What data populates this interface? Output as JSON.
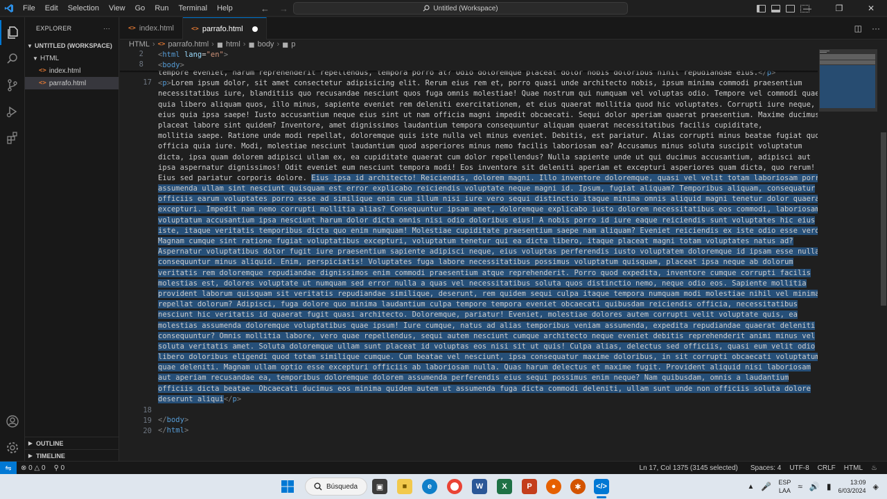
{
  "menu": {
    "items": [
      "File",
      "Edit",
      "Selection",
      "View",
      "Go",
      "Run",
      "Terminal",
      "Help"
    ]
  },
  "titlebar": {
    "search_text": "Untitled (Workspace)",
    "nav_back": "←",
    "nav_forward": "→"
  },
  "sidebar": {
    "title": "EXPLORER",
    "more": "···",
    "workspace": "UNTITLED (WORKSPACE)",
    "folder": "HTML",
    "files": [
      "index.html",
      "parrafo.html"
    ],
    "outline": "OUTLINE",
    "timeline": "TIMELINE"
  },
  "tabs": [
    {
      "label": "index.html"
    },
    {
      "label": "parrafo.html"
    }
  ],
  "breadcrumb": {
    "items": [
      "HTML",
      "parrafo.html",
      "html",
      "body",
      "p"
    ]
  },
  "editor": {
    "gutter": [
      "2",
      "8",
      "17",
      "18",
      "19",
      "20"
    ],
    "sticky": {
      "line2_tag": "html",
      "line2_attr": "lang",
      "line2_value": "\"en\"",
      "line8_tag": "body"
    },
    "first_partial": "tempore eveniet, harum reprehenderit repellendus, tempora porro at? Odio doloremque placeat dolor nobis doloribus nihil repudiandae eius.",
    "paragraph_unselected": [
      "Lorem ipsum dolor, sit amet consectetur adipisicing elit. Rerum eius rem et, porro quasi unde architecto nobis, ipsum minima commodi praesentium",
      "necessitatibus iure, blanditiis quo recusandae nesciunt quos fuga omnis molestiae! Quae nostrum qui numquam vel voluptas odio. Tempore vel commodi quae",
      "quia libero aliquam quos, illo minus, sapiente eveniet rem deleniti exercitationem, et eius quaerat mollitia quod hic voluptates. Corrupti iure neque,",
      "eius quia ipsa saepe! Iusto accusantium neque eius sint ut nam officia magni impedit obcaecati. Sequi dolor aperiam quaerat praesentium. Maxime ducimus",
      "placeat labore sint quidem? Inventore, amet dignissimos laudantium tempora consequuntur aliquam quaerat necessitatibus facilis cupiditate,",
      "mollitia saepe. Ratione unde modi repellat, doloremque quis iste nulla vel minus eveniet. Debitis, est pariatur. Alias corrupti minus beatae fugiat quos",
      "officia quia iure. Modi, molestiae nesciunt laudantium quod asperiores minus nemo facilis laboriosam ea? Accusamus minus soluta suscipit voluptatum",
      "dicta, ipsa quam dolorem adipisci ullam ex, ea cupiditate quaerat cum dolor repellendus? Nulla sapiente unde ut qui ducimus accusantium, adipisci aut",
      "ipsa aspernatur dignissimos! Odit eveniet eum nesciunt tempora modi! Eos inventore sit deleniti aperiam et excepturi asperiores quam dicta, quo rerum!"
    ],
    "sel_line_prefix": "Eius sed pariatur corporis dolore. ",
    "sel_line_selected": "Eius ipsa id architecto! Reiciendis, dolorem magni. Illo inventore doloremque, quasi vel velit totam laboriosam porro",
    "paragraph_selected": [
      "assumenda ullam sint nesciunt quisquam est error explicabo reiciendis voluptate neque magni id. Ipsum, fugiat aliquam? Temporibus aliquam, consequatur",
      "officiis earum voluptates porro esse ad similique enim cum illum nisi iure vero sequi distinctio itaque minima omnis aliquid magni tenetur dolor quaerat",
      "excepturi. Impedit nam nemo corrupti mollitia alias? Consequuntur ipsam amet, doloremque explicabo iusto dolorem necessitatibus eos commodi, laboriosam",
      "voluptatum accusantium ipsa nesciunt harum dolor dicta omnis nisi odio doloribus eius! A nobis porro id iure eaque reiciendis sunt voluptates hic eius",
      "iste, itaque veritatis temporibus dicta quo enim numquam! Molestiae cupiditate praesentium saepe nam aliquam? Eveniet reiciendis ex iste odio esse vero!",
      "Magnam cumque sint ratione fugiat voluptatibus excepturi, voluptatum tenetur qui ea dicta libero, itaque placeat magni totam voluptates natus ad?",
      "Aspernatur voluptatibus dolor fugit iure praesentium sapiente adipisci neque, eius voluptas perferendis iusto voluptatem doloremque id ipsam esse nulla",
      "consequuntur minus aliquid. Enim, perspiciatis! Voluptates fuga labore necessitatibus possimus voluptatum quisquam, placeat ipsa neque ab dolorum",
      "veritatis rem doloremque repudiandae dignissimos enim commodi praesentium atque reprehenderit. Porro quod expedita, inventore cumque corrupti facilis",
      "molestias est, dolores voluptate ut numquam sed error nulla a quas vel necessitatibus soluta quos distinctio nemo, neque odio eos. Sapiente mollitia",
      "provident laborum quisquam sit veritatis repudiandae similique, deserunt, rem quidem sequi culpa itaque tempora numquam modi molestiae nihil vel minima",
      "repellat dolorum? Adipisci, fuga dolore quo minima laudantium culpa tempore tempora eveniet obcaecati quibusdam reiciendis officia, necessitatibus",
      "nesciunt hic veritatis id quaerat fugit quasi architecto. Doloremque, pariatur! Eveniet, molestiae dolores autem corrupti velit voluptate quis, ea",
      "molestias assumenda doloremque voluptatibus quae ipsum! Iure cumque, natus ad alias temporibus veniam assumenda, expedita repudiandae quaerat deleniti",
      "consequuntur? Omnis mollitia labore, vero quae repellendus, sequi autem nesciunt cumque architecto neque eveniet debitis reprehenderit animi minus vel",
      "soluta veritatis amet. Soluta doloremque ullam sunt placeat id voluptas eos nisi sit ut quis! Culpa alias, delectus sed officiis, quasi eum velit odio",
      "libero doloribus eligendi quod totam similique cumque. Cum beatae vel nesciunt, ipsa consequatur maxime doloribus, in sit corrupti obcaecati voluptatum",
      "quae deleniti. Magnam ullam optio esse excepturi officiis ab laboriosam nulla. Quas harum delectus et maxime fugit. Provident aliquid nisi laboriosam",
      "aut aperiam recusandae ea, temporibus doloremque dolorem assumenda perferendis eius sequi possimus enim neque? Nam quibusdam, omnis a laudantium",
      "officiis dicta beatae. Obcaecati ducimus eos minima quidem autem ut assumenda fuga dicta commodi deleniti, ullam sunt unde non officiis soluta dolore"
    ],
    "last_selected": "deserunt aliqui",
    "close_p": "p",
    "close_body": "body",
    "close_html": "html"
  },
  "statusbar": {
    "errors": "0",
    "warnings": "0",
    "ports": "0",
    "cursor": "Ln 17, Col 1375 (3145 selected)",
    "spaces": "Spaces: 4",
    "encoding": "UTF-8",
    "eol": "CRLF",
    "language": "HTML"
  },
  "taskbar": {
    "search": "Búsqueda",
    "lang_top": "ESP",
    "lang_bottom": "LAA",
    "time": "13:09",
    "date": "6/03/2024"
  },
  "colors": {
    "accent": "#0078d4",
    "selection": "#264f78",
    "tag": "#569cd6",
    "string": "#ce9178",
    "attr": "#9cdcfe",
    "html_icon": "#e37933"
  }
}
